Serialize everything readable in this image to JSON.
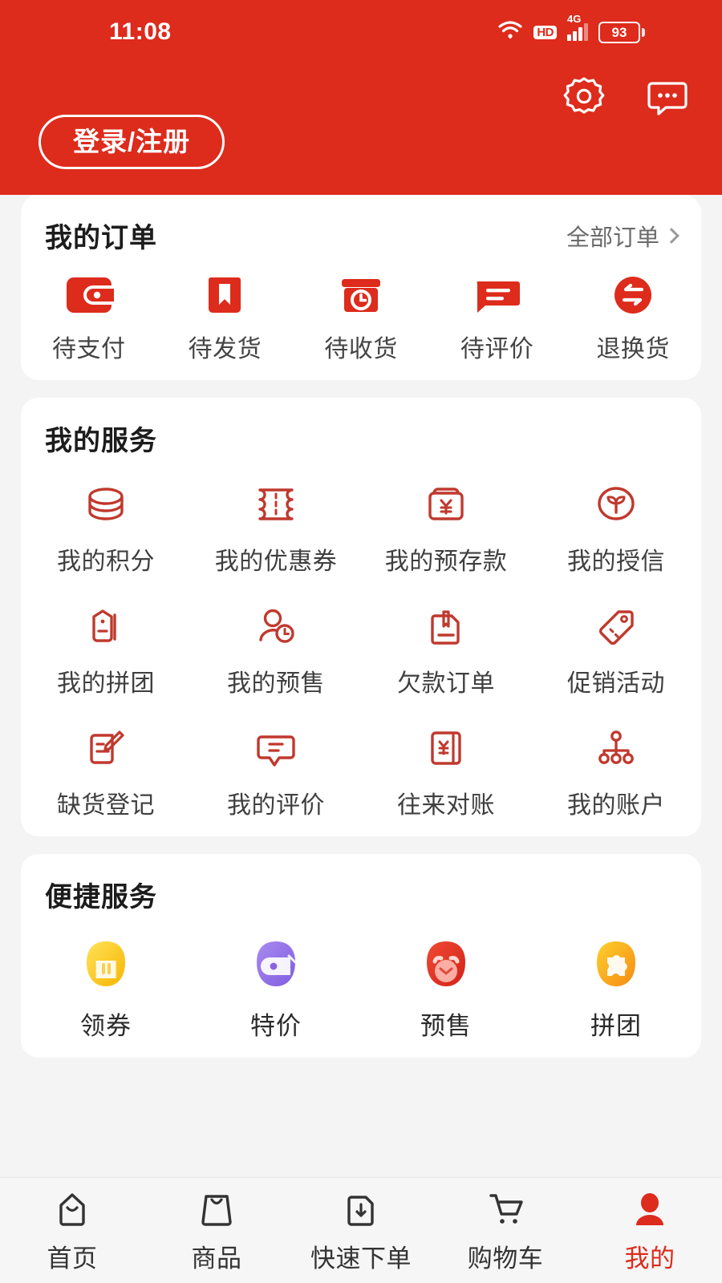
{
  "theme": {
    "brand_red": "#dd2b1c",
    "icon_outline_red": "#c0392e",
    "page_bg": "#f4f4f4",
    "card_bg": "#ffffff"
  },
  "status_bar": {
    "time": "11:08",
    "wifi_icon": "wifi-icon",
    "hd_label": "HD",
    "network_label": "4G",
    "battery_percent": "93"
  },
  "header": {
    "settings_icon": "gear-icon",
    "message_icon": "chat-bubble-icon",
    "login_button": "登录/注册"
  },
  "orders": {
    "title": "我的订单",
    "more_label": "全部订单",
    "more_icon": "chevron-right-icon",
    "items": [
      {
        "label": "待支付",
        "icon": "wallet-icon"
      },
      {
        "label": "待发货",
        "icon": "package-bookmark-icon"
      },
      {
        "label": "待收货",
        "icon": "box-clock-icon"
      },
      {
        "label": "待评价",
        "icon": "comment-icon"
      },
      {
        "label": "退换货",
        "icon": "return-swap-icon"
      }
    ]
  },
  "services": {
    "title": "我的服务",
    "items": [
      {
        "label": "我的积分",
        "icon": "coins-stack-icon"
      },
      {
        "label": "我的优惠券",
        "icon": "ticket-icon"
      },
      {
        "label": "我的预存款",
        "icon": "money-box-yen-icon"
      },
      {
        "label": "我的授信",
        "icon": "sprout-circle-icon"
      },
      {
        "label": "我的拼团",
        "icon": "group-tag-icon"
      },
      {
        "label": "我的预售",
        "icon": "person-clock-icon"
      },
      {
        "label": "欠款订单",
        "icon": "document-pen-icon"
      },
      {
        "label": "促销活动",
        "icon": "price-tag-icon"
      },
      {
        "label": "缺货登记",
        "icon": "note-edit-icon"
      },
      {
        "label": "我的评价",
        "icon": "speech-bubble-icon"
      },
      {
        "label": "往来对账",
        "icon": "ledger-yen-icon"
      },
      {
        "label": "我的账户",
        "icon": "org-tree-icon"
      }
    ]
  },
  "convenient": {
    "title": "便捷服务",
    "items": [
      {
        "label": "领券",
        "icon": "coupon-blob-icon",
        "color": "#fdd835",
        "color2": "#fbc02d"
      },
      {
        "label": "特价",
        "icon": "tag-blob-icon",
        "color": "#9575e8",
        "color2": "#8a63e0"
      },
      {
        "label": "预售",
        "icon": "alarm-blob-icon",
        "color": "#e53628",
        "color2": "#d62a1c"
      },
      {
        "label": "拼团",
        "icon": "puzzle-blob-icon",
        "color": "#ffc42e",
        "color2": "#f79a14"
      }
    ]
  },
  "tabbar": {
    "items": [
      {
        "label": "首页",
        "icon": "home-icon",
        "active": false
      },
      {
        "label": "商品",
        "icon": "shopping-bag-icon",
        "active": false
      },
      {
        "label": "快速下单",
        "icon": "quick-order-icon",
        "active": false
      },
      {
        "label": "购物车",
        "icon": "cart-icon",
        "active": false
      },
      {
        "label": "我的",
        "icon": "user-icon",
        "active": true
      }
    ]
  }
}
